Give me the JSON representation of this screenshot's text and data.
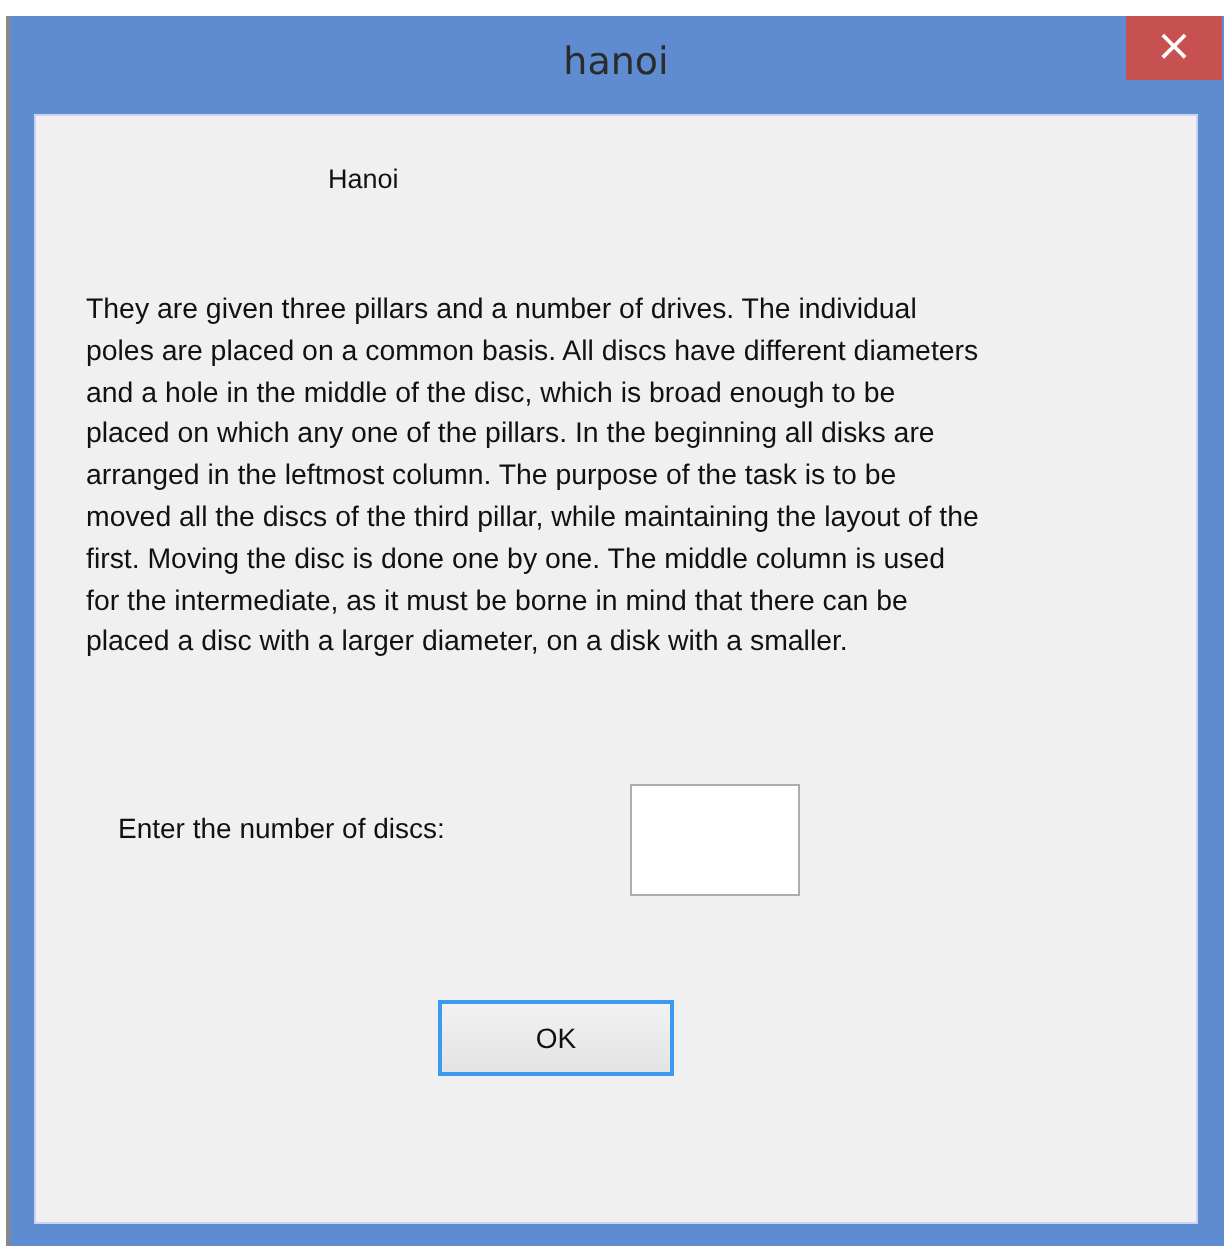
{
  "window": {
    "title": "hanoi",
    "close": "×"
  },
  "heading": "Hanoi",
  "description": "They are given three pillars and a number of drives. The individual poles are placed on a common basis. All discs have different diameters and a hole in the middle of the disc, which is broad enough to be placed on which any one of the pillars. In the beginning all disks are arranged in the leftmost column. The purpose of the task is to be moved all the discs of the third pillar, while maintaining the layout of the first. Moving the disc is done one by one. The middle column is used for the intermediate, as it must be borne in mind that there can be placed a disc with a larger diameter, on a disk with a smaller.",
  "discs_field": {
    "label": "Enter the number of discs:"
  },
  "ok_button": {
    "label": "OK",
    "focused": true
  }
}
